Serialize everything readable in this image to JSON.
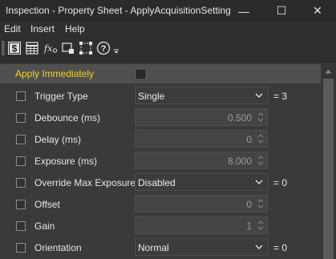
{
  "window": {
    "title": "Inspection - Property Sheet - ApplyAcquisitionSetting",
    "minimize_glyph": "—",
    "maximize_glyph": "☐",
    "close_glyph": "✕"
  },
  "menu": {
    "items": [
      {
        "label": "Edit"
      },
      {
        "label": "Insert"
      },
      {
        "label": "Help"
      }
    ]
  },
  "toolbar": {
    "buttons": [
      {
        "icon": "categorized-dollar-icon"
      },
      {
        "icon": "table-grid-icon"
      },
      {
        "icon": "function-fx-icon"
      },
      {
        "icon": "select-region-icon"
      },
      {
        "icon": "resize-crop-icon"
      },
      {
        "icon": "help-question-icon"
      },
      {
        "icon": "overflow-dropdown-icon"
      }
    ]
  },
  "properties": {
    "apply_immediately": {
      "label": "Apply Immediately",
      "checked": false,
      "label_color": "#f0d21c"
    },
    "rows": [
      {
        "label": "Trigger Type",
        "kind": "select",
        "value": "Single",
        "suffix": "= 3"
      },
      {
        "label": "Debounce (ms)",
        "kind": "spin",
        "value": "0.500"
      },
      {
        "label": "Delay (ms)",
        "kind": "spin",
        "value": "0"
      },
      {
        "label": "Exposure (ms)",
        "kind": "spin",
        "value": "8.000"
      },
      {
        "label": "Override Max Exposure",
        "kind": "select",
        "value": "Disabled",
        "suffix": "= 0"
      },
      {
        "label": "Offset",
        "kind": "spin",
        "value": "0"
      },
      {
        "label": "Gain",
        "kind": "spin",
        "value": "1"
      },
      {
        "label": "Orientation",
        "kind": "select",
        "value": "Normal",
        "suffix": "= 0"
      }
    ]
  }
}
